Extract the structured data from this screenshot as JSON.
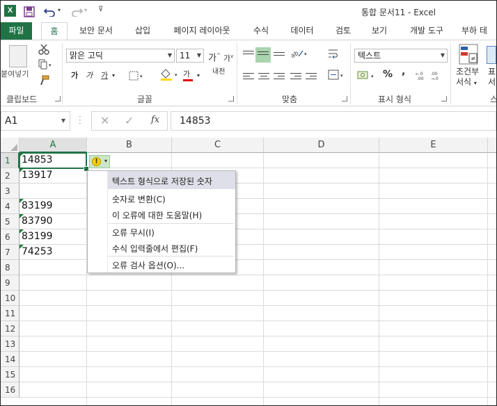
{
  "app": {
    "logo_letter": "X",
    "title": "통합 문서11 - Excel"
  },
  "quick_access": {
    "save_icon": "save-icon",
    "undo_icon": "undo-icon",
    "redo_icon": "redo-icon"
  },
  "tabs": [
    {
      "label": "파일"
    },
    {
      "label": "홈"
    },
    {
      "label": "보안 문서"
    },
    {
      "label": "삽입"
    },
    {
      "label": "페이지 레이아웃"
    },
    {
      "label": "수식"
    },
    {
      "label": "데이터"
    },
    {
      "label": "검토"
    },
    {
      "label": "보기"
    },
    {
      "label": "개발 도구"
    },
    {
      "label": "부하 테"
    }
  ],
  "ribbon": {
    "clipboard": {
      "paste_label": "붙여넣기",
      "group_label": "클립보드"
    },
    "font": {
      "font_name": "맑은 고딕",
      "font_size": "11",
      "bold": "가",
      "italic": "가",
      "underline": "가",
      "font_color": "가",
      "phonetic": "내천",
      "grow": "가",
      "shrink": "가",
      "group_label": "글꼴"
    },
    "alignment": {
      "group_label": "맞춤"
    },
    "number": {
      "format": "텍스트",
      "percent": "%",
      "comma": ",",
      "group_label": "표시 형식"
    },
    "styles": {
      "conditional_label_1": "조건부",
      "conditional_label_2": "서식",
      "next_label_1": "표",
      "next_label_2": "서",
      "group_label": "스"
    }
  },
  "formula_bar": {
    "name_box": "A1",
    "fx": "fx",
    "value": "14853"
  },
  "columns": [
    "A",
    "B",
    "C",
    "D",
    "E"
  ],
  "rows": [
    "1",
    "2",
    "3",
    "4",
    "5",
    "6",
    "7",
    "8",
    "9",
    "10",
    "11",
    "12",
    "13",
    "14",
    "15",
    "16"
  ],
  "cells": [
    {
      "row": 1,
      "value": "14853"
    },
    {
      "row": 2,
      "value": "13917"
    },
    {
      "row": 4,
      "value": "83199"
    },
    {
      "row": 5,
      "value": "83790"
    },
    {
      "row": 6,
      "value": "83199"
    },
    {
      "row": 7,
      "value": "74253"
    }
  ],
  "error_menu": {
    "header": "텍스트 형식으로 저장된 숫자",
    "convert": "숫자로 변환(C)",
    "help": "이 오류에 대한 도움말(H)",
    "ignore": "오류 무시(I)",
    "edit": "수식 입력줄에서 편집(F)",
    "options": "오류 검사 옵션(O)..."
  },
  "colors": {
    "excel_green": "#217346",
    "error_triangle": "#1e7e3f",
    "warning": "#ffd000"
  }
}
